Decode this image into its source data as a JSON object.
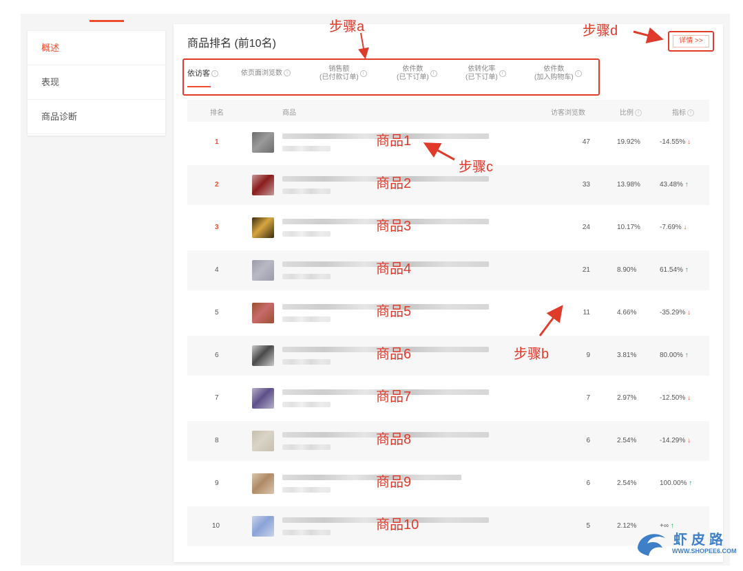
{
  "sidebar": {
    "items": [
      {
        "label": "概述",
        "active": true
      },
      {
        "label": "表现",
        "active": false
      },
      {
        "label": "商品诊断",
        "active": false
      }
    ]
  },
  "main": {
    "title": "商品排名 (前10名)",
    "detail_button": "详情 >>",
    "tabs": [
      {
        "line1": "依访客",
        "line2": "",
        "active": true
      },
      {
        "line1": "依页面浏览数",
        "line2": "",
        "active": false
      },
      {
        "line1": "销售额",
        "line2": "(已付款订单)",
        "active": false
      },
      {
        "line1": "依件数",
        "line2": "(已下订单)",
        "active": false
      },
      {
        "line1": "依转化率",
        "line2": "(已下订单)",
        "active": false
      },
      {
        "line1": "依件数",
        "line2": "(加入购物车)",
        "active": false
      }
    ],
    "columns": {
      "rank": "排名",
      "product": "商品",
      "views": "访客浏览数",
      "ratio": "比例",
      "index": "指标"
    },
    "rows": [
      {
        "rank": "1",
        "name": "商品1",
        "views": "47",
        "ratio": "19.92%",
        "index": "-14.55%",
        "dir": "down"
      },
      {
        "rank": "2",
        "name": "商品2",
        "views": "33",
        "ratio": "13.98%",
        "index": "43.48%",
        "dir": "up"
      },
      {
        "rank": "3",
        "name": "商品3",
        "views": "24",
        "ratio": "10.17%",
        "index": "-7.69%",
        "dir": "down"
      },
      {
        "rank": "4",
        "name": "商品4",
        "views": "21",
        "ratio": "8.90%",
        "index": "61.54%",
        "dir": "up"
      },
      {
        "rank": "5",
        "name": "商品5",
        "views": "11",
        "ratio": "4.66%",
        "index": "-35.29%",
        "dir": "down"
      },
      {
        "rank": "6",
        "name": "商品6",
        "views": "9",
        "ratio": "3.81%",
        "index": "80.00%",
        "dir": "up"
      },
      {
        "rank": "7",
        "name": "商品7",
        "views": "7",
        "ratio": "2.97%",
        "index": "-12.50%",
        "dir": "down"
      },
      {
        "rank": "8",
        "name": "商品8",
        "views": "6",
        "ratio": "2.54%",
        "index": "-14.29%",
        "dir": "down"
      },
      {
        "rank": "9",
        "name": "商品9",
        "views": "6",
        "ratio": "2.54%",
        "index": "100.00%",
        "dir": "up"
      },
      {
        "rank": "10",
        "name": "商品10",
        "views": "5",
        "ratio": "2.12%",
        "index": "+∞",
        "dir": "up"
      }
    ]
  },
  "annotations": {
    "step_a": "步骤a",
    "step_b": "步骤b",
    "step_c": "步骤c",
    "step_d": "步骤d"
  },
  "watermark": {
    "text": "虾皮路",
    "url": "WWW.SHOPEE6.COM"
  },
  "colors": {
    "accent": "#ee4d2d",
    "annotation": "#e03a2a",
    "up": "#1aa35a",
    "down": "#ee4d2d"
  },
  "icons": {
    "info": "info-circle-icon",
    "up": "arrow-up-icon",
    "down": "arrow-down-icon"
  }
}
